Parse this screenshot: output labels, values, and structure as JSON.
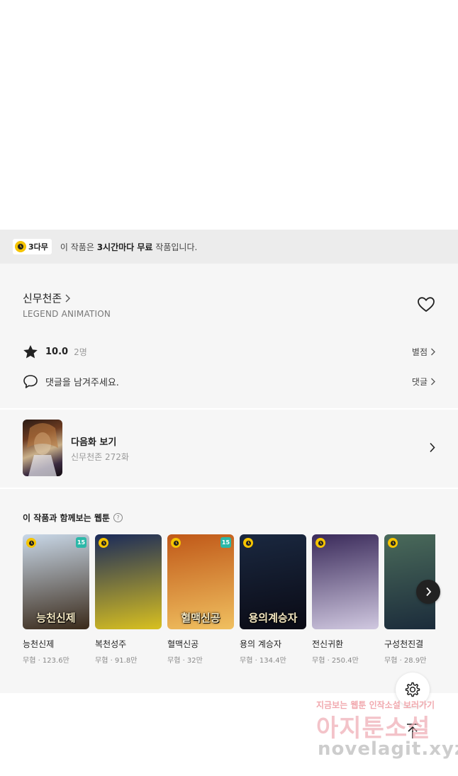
{
  "notice": {
    "badge": "3다무",
    "text_prefix": "이 작품은 ",
    "text_bold": "3시간마다 무료",
    "text_suffix": " 작품입니다."
  },
  "series": {
    "title": "신무천존",
    "author": "LEGEND ANIMATION",
    "rating": "10.0",
    "rating_count": "2명",
    "rate_link": "별점",
    "comment_prompt": "댓글을 남겨주세요.",
    "comment_link": "댓글"
  },
  "next_episode": {
    "label": "다음화 보기",
    "sub": "신무천존 272화"
  },
  "recommendations": {
    "title": "이 작품과 함께보는 웹툰",
    "help": "?",
    "items": [
      {
        "name": "능천신제",
        "meta": "무협 · 123.6만",
        "overlay": "능천신제",
        "age": "15",
        "color_top": "#c9d8e8",
        "color_bot": "#3a2a1a"
      },
      {
        "name": "복천성주",
        "meta": "무협 · 91.8만",
        "overlay": "",
        "age": "",
        "color_top": "#1a2a5a",
        "color_bot": "#d8c020"
      },
      {
        "name": "혈맥신공",
        "meta": "무협 · 32만",
        "overlay": "혈맥신공",
        "age": "15",
        "color_top": "#c05818",
        "color_bot": "#f0c060"
      },
      {
        "name": "용의 계승자",
        "meta": "무협 · 134.4만",
        "overlay": "용의계승자",
        "age": "",
        "color_top": "#1a2840",
        "color_bot": "#0a0a14"
      },
      {
        "name": "전신귀환",
        "meta": "무협 · 250.4만",
        "overlay": "",
        "age": "",
        "color_top": "#3a2a5a",
        "color_bot": "#d0c8e0"
      },
      {
        "name": "구성천진결",
        "meta": "무협 · 28.9만",
        "overlay": "",
        "age": "",
        "color_top": "#4a6a5a",
        "color_bot": "#1a2a3a"
      }
    ]
  },
  "watermark": {
    "line1": "지금보는 웹툰 인작소설 보러가기",
    "line2": "아지툰소설",
    "line3": "novelagit.xyz"
  }
}
